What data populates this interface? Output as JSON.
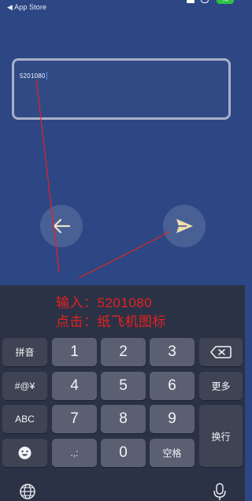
{
  "status_bar": {
    "back_label": "◀ App Store",
    "battery": "74"
  },
  "input": {
    "value": "5201080"
  },
  "instruction": {
    "line1": "输入：5201080",
    "line2": "点击：纸飞机图标"
  },
  "keyboard": {
    "pinyin": "拼音",
    "symbols": "#@¥",
    "abc": "ABC",
    "more": "更多",
    "newline": "换行",
    "space": "空格",
    "punct": ".,:",
    "digits": [
      "1",
      "2",
      "3",
      "4",
      "5",
      "6",
      "7",
      "8",
      "9",
      "0"
    ]
  },
  "colors": {
    "background": "#2c4784",
    "keyboard": "#2b3245",
    "annotation": "#e8201f",
    "send_icon": "#f1ddb0"
  },
  "icons": {
    "back": "arrow-left-icon",
    "send": "paper-plane-icon",
    "delete": "backspace-icon",
    "emoji": "emoji-icon",
    "globe": "globe-icon",
    "mic": "microphone-icon"
  }
}
